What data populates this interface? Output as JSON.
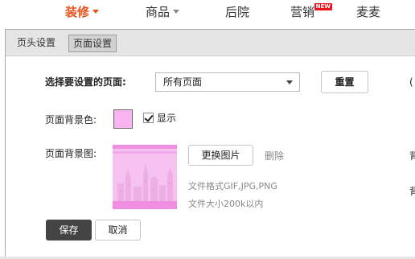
{
  "topnav": {
    "items": [
      {
        "label": "装修"
      },
      {
        "label": "商品"
      },
      {
        "label": "后院"
      },
      {
        "label": "营销",
        "badge": "NEW"
      },
      {
        "label": "麦麦"
      }
    ]
  },
  "tabs": [
    {
      "label": "页头设置"
    },
    {
      "label": "页面设置"
    }
  ],
  "form": {
    "select_page_label": "选择要设置的页面:",
    "select_page_value": "所有页面",
    "reset_label": "重置",
    "bg_color_label": "页面背景色:",
    "bg_color_value": "#f8b4f0",
    "show_label": "显示",
    "show_checked": true,
    "bg_image_label": "页面背景图:",
    "change_image_label": "更换图片",
    "delete_label": "删除",
    "format_hint": "文件格式GIF,JPG,PNG",
    "size_hint": "文件大小200k以内",
    "save_label": "保存",
    "cancel_label": "取消"
  },
  "right_edge": {
    "label_1": "背",
    "label_2": "背"
  },
  "colors": {
    "accent": "#e8541e",
    "badge": "#e8141e",
    "swatch": "#f8b4f0",
    "save_button": "#444444"
  }
}
